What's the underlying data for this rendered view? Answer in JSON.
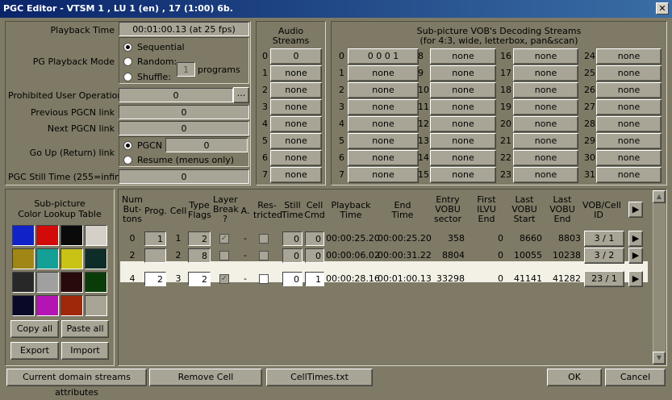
{
  "window": {
    "title": "PGC Editor - VTSM 1 , LU 1 (en) , 17  (1:00)  6b.",
    "close_glyph": "✕"
  },
  "playback": {
    "time_label": "Playback Time",
    "time_value": "00:01:00.13 (at 25 fps)",
    "mode_label": "PG Playback Mode",
    "sequential": "Sequential",
    "random": "Random:",
    "shuffle": "Shuffle:",
    "programs_value": "1",
    "programs_label": "programs",
    "prohibited_label": "Prohibited User Operations",
    "prohibited_value": "0",
    "browse": "...",
    "prev_label": "Previous PGCN link",
    "prev_value": "0",
    "next_label": "Next PGCN link",
    "next_value": "0",
    "goup_label": "Go Up (Return) link",
    "pgcn_label": "PGCN",
    "pgcn_value": "0",
    "resume_label": "Resume (menus only)",
    "still_label": "PGC Still Time (255=infinite)",
    "still_value": "0"
  },
  "audio": {
    "title1": "Audio",
    "title2": "Streams",
    "rows": [
      [
        "0",
        "0"
      ],
      [
        "1",
        "none"
      ],
      [
        "2",
        "none"
      ],
      [
        "3",
        "none"
      ],
      [
        "4",
        "none"
      ],
      [
        "5",
        "none"
      ],
      [
        "6",
        "none"
      ],
      [
        "7",
        "none"
      ]
    ]
  },
  "subpic": {
    "title1": "Sub-picture VOB's Decoding Streams",
    "title2": "(for 4:3, wide, letterbox, pan&scan)",
    "columns": [
      [
        [
          "0",
          "0  0  0  1"
        ],
        [
          "1",
          "none"
        ],
        [
          "2",
          "none"
        ],
        [
          "3",
          "none"
        ],
        [
          "4",
          "none"
        ],
        [
          "5",
          "none"
        ],
        [
          "6",
          "none"
        ],
        [
          "7",
          "none"
        ]
      ],
      [
        [
          "8",
          "none"
        ],
        [
          "9",
          "none"
        ],
        [
          "10",
          "none"
        ],
        [
          "11",
          "none"
        ],
        [
          "12",
          "none"
        ],
        [
          "13",
          "none"
        ],
        [
          "14",
          "none"
        ],
        [
          "15",
          "none"
        ]
      ],
      [
        [
          "16",
          "none"
        ],
        [
          "17",
          "none"
        ],
        [
          "18",
          "none"
        ],
        [
          "19",
          "none"
        ],
        [
          "20",
          "none"
        ],
        [
          "21",
          "none"
        ],
        [
          "22",
          "none"
        ],
        [
          "23",
          "none"
        ]
      ],
      [
        [
          "24",
          "none"
        ],
        [
          "25",
          "none"
        ],
        [
          "26",
          "none"
        ],
        [
          "27",
          "none"
        ],
        [
          "28",
          "none"
        ],
        [
          "29",
          "none"
        ],
        [
          "30",
          "none"
        ],
        [
          "31",
          "none"
        ]
      ]
    ]
  },
  "clut": {
    "title1": "Sub-picture",
    "title2": "Color Lookup Table",
    "colors": [
      "#0f23c8",
      "#d20a0a",
      "#0a0a0a",
      "#d4d0c8",
      "#a08614",
      "#14a096",
      "#c8c314",
      "#0f2d28",
      "#282828",
      "#a0a0a0",
      "#280a0a",
      "#0a3c0a",
      "#0a0a28",
      "#b414b4",
      "#a0280a",
      "#a8a596"
    ],
    "copy_all": "Copy all",
    "paste_all": "Paste all",
    "export": "Export",
    "import": "Import"
  },
  "table": {
    "headers": [
      [
        "Num",
        "But-",
        "tons"
      ],
      [
        "Prog."
      ],
      [
        "Cell"
      ],
      [
        "Type",
        "Flags"
      ],
      [
        "Layer",
        "Break",
        "?"
      ],
      [
        "A."
      ],
      [
        "Res-",
        "tricted"
      ],
      [
        "Still",
        "Time"
      ],
      [
        "Cell",
        "Cmd"
      ],
      [
        "Playback",
        "Time"
      ],
      [
        "End",
        "Time"
      ],
      [
        "Entry",
        "VOBU",
        "sector"
      ],
      [
        "First",
        "ILVU",
        "End"
      ],
      [
        "Last",
        "VOBU",
        "Start"
      ],
      [
        "Last",
        "VOBU",
        "End"
      ],
      [
        "VOB/Cell",
        "ID"
      ]
    ],
    "arrow": "▶",
    "rows": [
      {
        "buttons": "0",
        "prog": "1",
        "cell": "1",
        "type": "2",
        "layer": "✓",
        "a": "-",
        "still": "0",
        "cmd": "0",
        "play": "00:00:25.20",
        "end": "00:00:25.20",
        "entry": "358",
        "first": "0",
        "lstart": "8660",
        "lend": "8803",
        "vob": "3 / 1"
      },
      {
        "buttons": "2",
        "prog": "",
        "cell": "2",
        "type": "8",
        "layer": "",
        "a": "-",
        "still": "0",
        "cmd": "0",
        "play": "00:00:06.02",
        "end": "00:00:31.22",
        "entry": "8804",
        "first": "0",
        "lstart": "10055",
        "lend": "10238",
        "vob": "3 / 2"
      },
      {
        "buttons": "4",
        "prog": "2",
        "cell": "3",
        "type": "2",
        "layer": "✓",
        "a": "-",
        "still": "0",
        "cmd": "1",
        "play": "00:00:28.16",
        "end": "00:01:00.13",
        "entry": "33298",
        "first": "0",
        "lstart": "41141",
        "lend": "41282",
        "vob": "23 / 1"
      }
    ],
    "scroll_up": "▲",
    "scroll_down": "▼"
  },
  "footer": {
    "streams": "Current domain streams attributes",
    "remove": "Remove Cell",
    "celltimes": "CellTimes.txt",
    "ok": "OK",
    "cancel": "Cancel"
  }
}
